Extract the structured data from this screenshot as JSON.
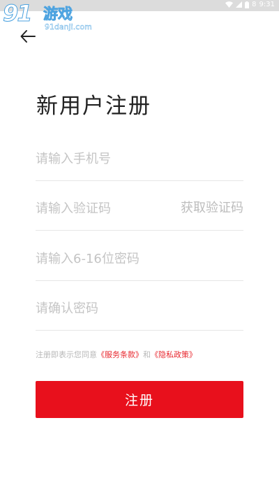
{
  "status_bar": {
    "time": "9:31",
    "battery": "8"
  },
  "watermark": {
    "logo_number": "91",
    "logo_text": "游戏",
    "url": "91danji.com"
  },
  "header": {
    "title": "新用户注册"
  },
  "form": {
    "phone_placeholder": "请输入手机号",
    "code_placeholder": "请输入验证码",
    "get_code_label": "获取验证码",
    "password_placeholder": "请输入6-16位密码",
    "confirm_placeholder": "请确认密码"
  },
  "agreement": {
    "prefix": "注册即表示您同意",
    "terms_label": "《服务条款》",
    "and_label": "和",
    "privacy_label": "《隐私政策》"
  },
  "actions": {
    "register_label": "注册"
  },
  "colors": {
    "accent": "#e8101c",
    "link": "#e8282f"
  }
}
